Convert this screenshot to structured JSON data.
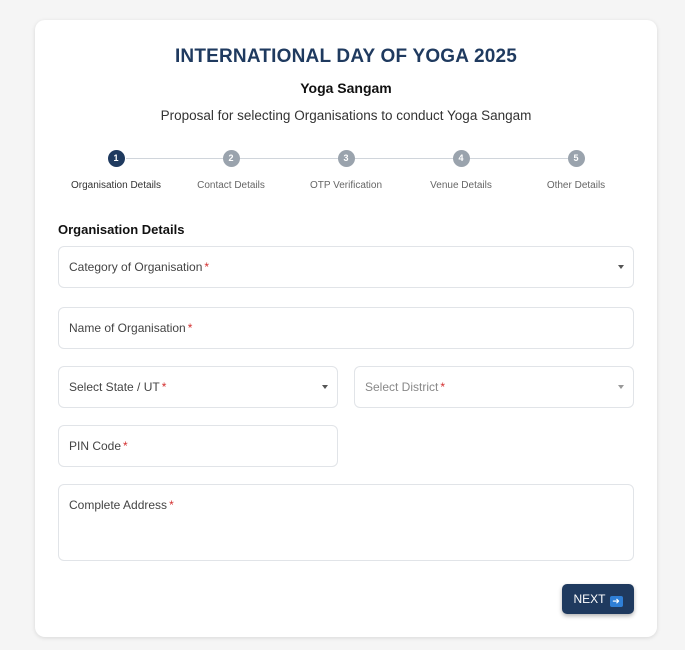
{
  "header": {
    "title": "INTERNATIONAL DAY OF YOGA 2025",
    "subtitle": "Yoga Sangam",
    "description": "Proposal for selecting Organisations to conduct Yoga Sangam"
  },
  "stepper": {
    "current_step": 1,
    "steps": [
      {
        "number": "1",
        "label": "Organisation Details"
      },
      {
        "number": "2",
        "label": "Contact Details"
      },
      {
        "number": "3",
        "label": "OTP Verification"
      },
      {
        "number": "4",
        "label": "Venue Details"
      },
      {
        "number": "5",
        "label": "Other Details"
      }
    ]
  },
  "form": {
    "section_title": "Organisation Details",
    "required_mark": "*",
    "category": {
      "label": "Category of Organisation",
      "value": ""
    },
    "name": {
      "label": "Name of Organisation",
      "value": ""
    },
    "state": {
      "label": "Select State / UT",
      "value": ""
    },
    "district": {
      "label": "Select District",
      "value": ""
    },
    "pin": {
      "label": "PIN Code",
      "value": ""
    },
    "address": {
      "label": "Complete Address",
      "value": ""
    },
    "next_label": "NEXT",
    "next_icon": "right-arrow-icon"
  },
  "colors": {
    "primary": "#1f3a5f",
    "required": "#d32f2f",
    "inactive_step": "#9aa3ad"
  }
}
